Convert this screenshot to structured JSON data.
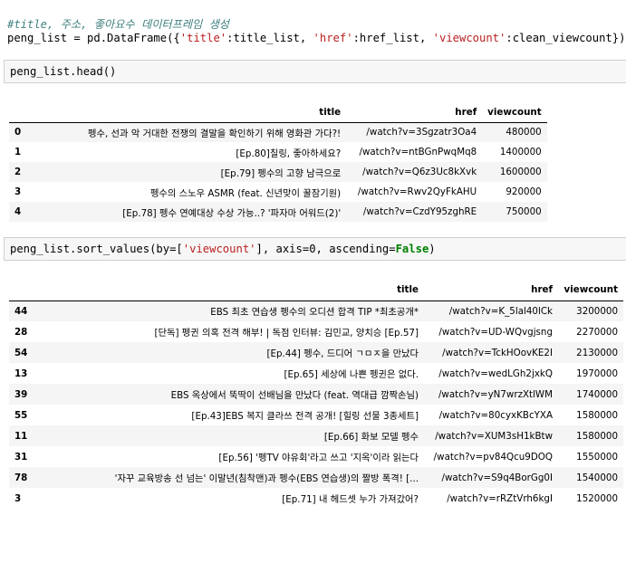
{
  "cell1": {
    "comment": "#title, 주소, 좋아요수 데이터프레임 생성",
    "code_prefix": "peng_list = pd.DataFrame({",
    "k1": "'title'",
    "v1": ":title_list, ",
    "k2": "'href'",
    "v2": ":href_list, ",
    "k3": "'viewcount'",
    "v3": ":clean_viewcount})"
  },
  "cell2": {
    "code": "peng_list.head()"
  },
  "head_table": {
    "columns": [
      "",
      "title",
      "href",
      "viewcount"
    ],
    "rows": [
      [
        "0",
        "펭수, 선과 악 거대한 전쟁의 결말을 확인하기 위해 영화관 가다?!",
        "/watch?v=3Sgzatr3Oa4",
        "480000"
      ],
      [
        "1",
        "[Ep.80]칠링, 좋아하세요?",
        "/watch?v=ntBGnPwqMq8",
        "1400000"
      ],
      [
        "2",
        "[Ep.79] 펭수의 고향 남극으로",
        "/watch?v=Q6z3Uc8kXvk",
        "1600000"
      ],
      [
        "3",
        "펭수의 스노우 ASMR (feat. 신년맞이 꿀잠기원)",
        "/watch?v=Rwv2QyFkAHU",
        "920000"
      ],
      [
        "4",
        "[Ep.78] 펭수 연예대상 수상 가능..? '파자마 어워드(2)'",
        "/watch?v=CzdY95zghRE",
        "750000"
      ]
    ]
  },
  "cell3": {
    "prefix": "peng_list.sort_values(by=[",
    "arg_str": "'viewcount'",
    "middle": "], axis=0, ascending=",
    "kw": "False",
    "suffix": ")"
  },
  "sort_table": {
    "columns": [
      "",
      "title",
      "href",
      "viewcount"
    ],
    "rows": [
      [
        "44",
        "EBS 최초 연습생 펭수의 오디션 합격 TIP *최초공개*",
        "/watch?v=K_5lal40lCk",
        "3200000"
      ],
      [
        "28",
        "[단독] 펭귄 의혹 전격 해부! | 독점 인터뷰: 김민교, 양치승 [Ep.57]",
        "/watch?v=UD-WQvgjsng",
        "2270000"
      ],
      [
        "54",
        "[Ep.44] 펭수, 드디어 ㄱㅁㅈ을 만났다",
        "/watch?v=TckHOovKE2I",
        "2130000"
      ],
      [
        "13",
        "[Ep.65] 세상에 나쁜 펭귄은 없다.",
        "/watch?v=wedLGh2jxkQ",
        "1970000"
      ],
      [
        "39",
        "EBS 옥상에서 뚝딱이 선배님을 만났다 (feat. 역대급 깜짝손님)",
        "/watch?v=yN7wrzXtlWM",
        "1740000"
      ],
      [
        "55",
        "[Ep.43]EBS 복지 클라쓰 전격 공개! [힐링 선물 3종세트]",
        "/watch?v=80cyxKBcYXA",
        "1580000"
      ],
      [
        "11",
        "[Ep.66] 화보 모델 펭수",
        "/watch?v=XUM3sH1kBtw",
        "1580000"
      ],
      [
        "31",
        "[Ep.56] '펭TV 야유회'라고 쓰고 '지옥'이라 읽는다",
        "/watch?v=pv84Qcu9DOQ",
        "1550000"
      ],
      [
        "78",
        "'자꾸 교육방송 선 넘는' 이말년(침착맨)과 펭수(EBS 연습생)의 짤방 폭격! [...",
        "/watch?v=S9q4BorGg0I",
        "1540000"
      ],
      [
        "3",
        "[Ep.71] 내 헤드셋 누가 가져갔어?",
        "/watch?v=rRZtVrh6kgI",
        "1520000"
      ]
    ]
  }
}
